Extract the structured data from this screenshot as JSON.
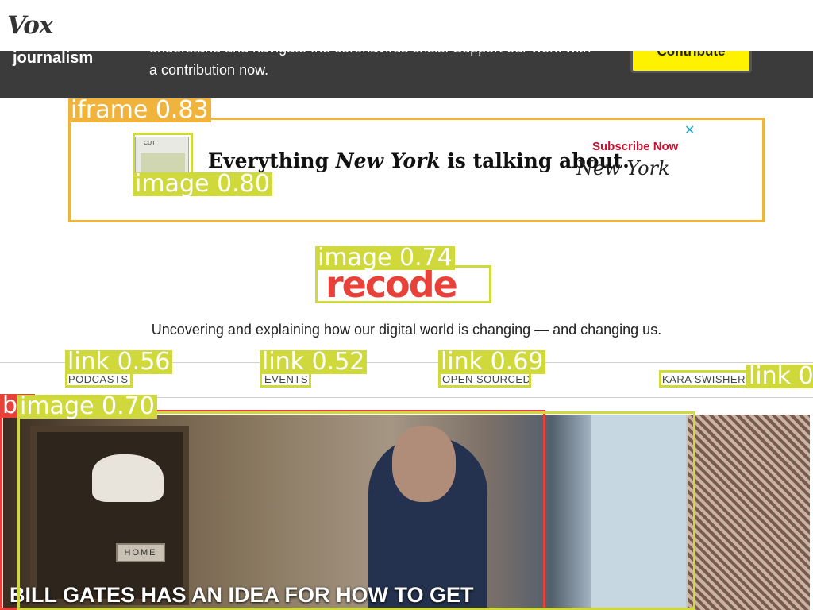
{
  "header": {
    "logo_text": "Vox"
  },
  "banner": {
    "left_text": "journalism",
    "message": "understand and navigate the coronavirus crisis. Support our work with a contribution now.",
    "button_label": "Contribute"
  },
  "ad": {
    "headline_pre": "Everything ",
    "headline_em": "New York",
    "headline_post": " is talking about.",
    "cta": "Subscribe Now",
    "brand": "New York",
    "close": "✕",
    "thumb_text": "CUT"
  },
  "site": {
    "logo_text": "recode",
    "tagline": "Uncovering and explaining how our digital world is changing — and changing us."
  },
  "nav": {
    "items": [
      {
        "label": "PODCASTS"
      },
      {
        "label": "EVENTS"
      },
      {
        "label": "OPEN SOURCED"
      },
      {
        "label": "KARA SWISHER"
      }
    ]
  },
  "hero": {
    "title": "BILL GATES HAS AN IDEA FOR HOW TO GET",
    "plaque": "HOME"
  },
  "detections": {
    "iframe": "iframe 0.83",
    "ad_image": "image 0.80",
    "logo_image": "image 0.74",
    "link_podcasts": "link 0.56",
    "link_events": "link 0.52",
    "link_open_sourced": "link 0.69",
    "link_kara": "link 0",
    "hero_image": "image 0.70",
    "hero_red": "bu"
  },
  "colors": {
    "banner_bg": "#3b3b3b",
    "contribute_yellow": "#fff200",
    "recode_red": "#e8413a",
    "iframe_box": "#f0b43c",
    "image_box": "#cfd93c",
    "red_box": "#e8413a"
  }
}
